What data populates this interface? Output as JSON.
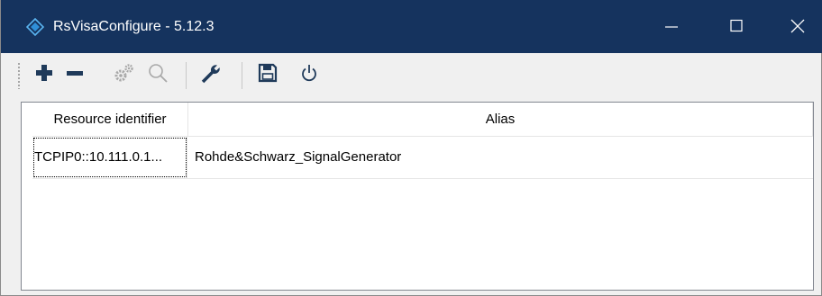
{
  "window": {
    "title": "RsVisaConfigure - 5.12.3",
    "titlebar_color": "#15335e",
    "controls": {
      "minimize": "minimize-icon",
      "maximize": "maximize-icon",
      "close": "close-icon"
    }
  },
  "toolbar": {
    "buttons": [
      {
        "name": "add-button",
        "icon": "plus-icon",
        "enabled": true
      },
      {
        "name": "remove-button",
        "icon": "minus-icon",
        "enabled": true
      },
      {
        "name": "settings-button",
        "icon": "gears-icon",
        "enabled": false
      },
      {
        "name": "find-button",
        "icon": "magnifier-icon",
        "enabled": false
      },
      {
        "name": "tools-button",
        "icon": "wrench-icon",
        "enabled": true
      },
      {
        "name": "save-button",
        "icon": "floppy-disk-icon",
        "enabled": true
      },
      {
        "name": "power-button",
        "icon": "power-icon",
        "enabled": true
      }
    ]
  },
  "table": {
    "columns": [
      "Resource identifier",
      "Alias"
    ],
    "rows": [
      [
        "TCPIP0::10.111.0.1...",
        "Rohde&Schwarz_SignalGenerator"
      ]
    ]
  }
}
